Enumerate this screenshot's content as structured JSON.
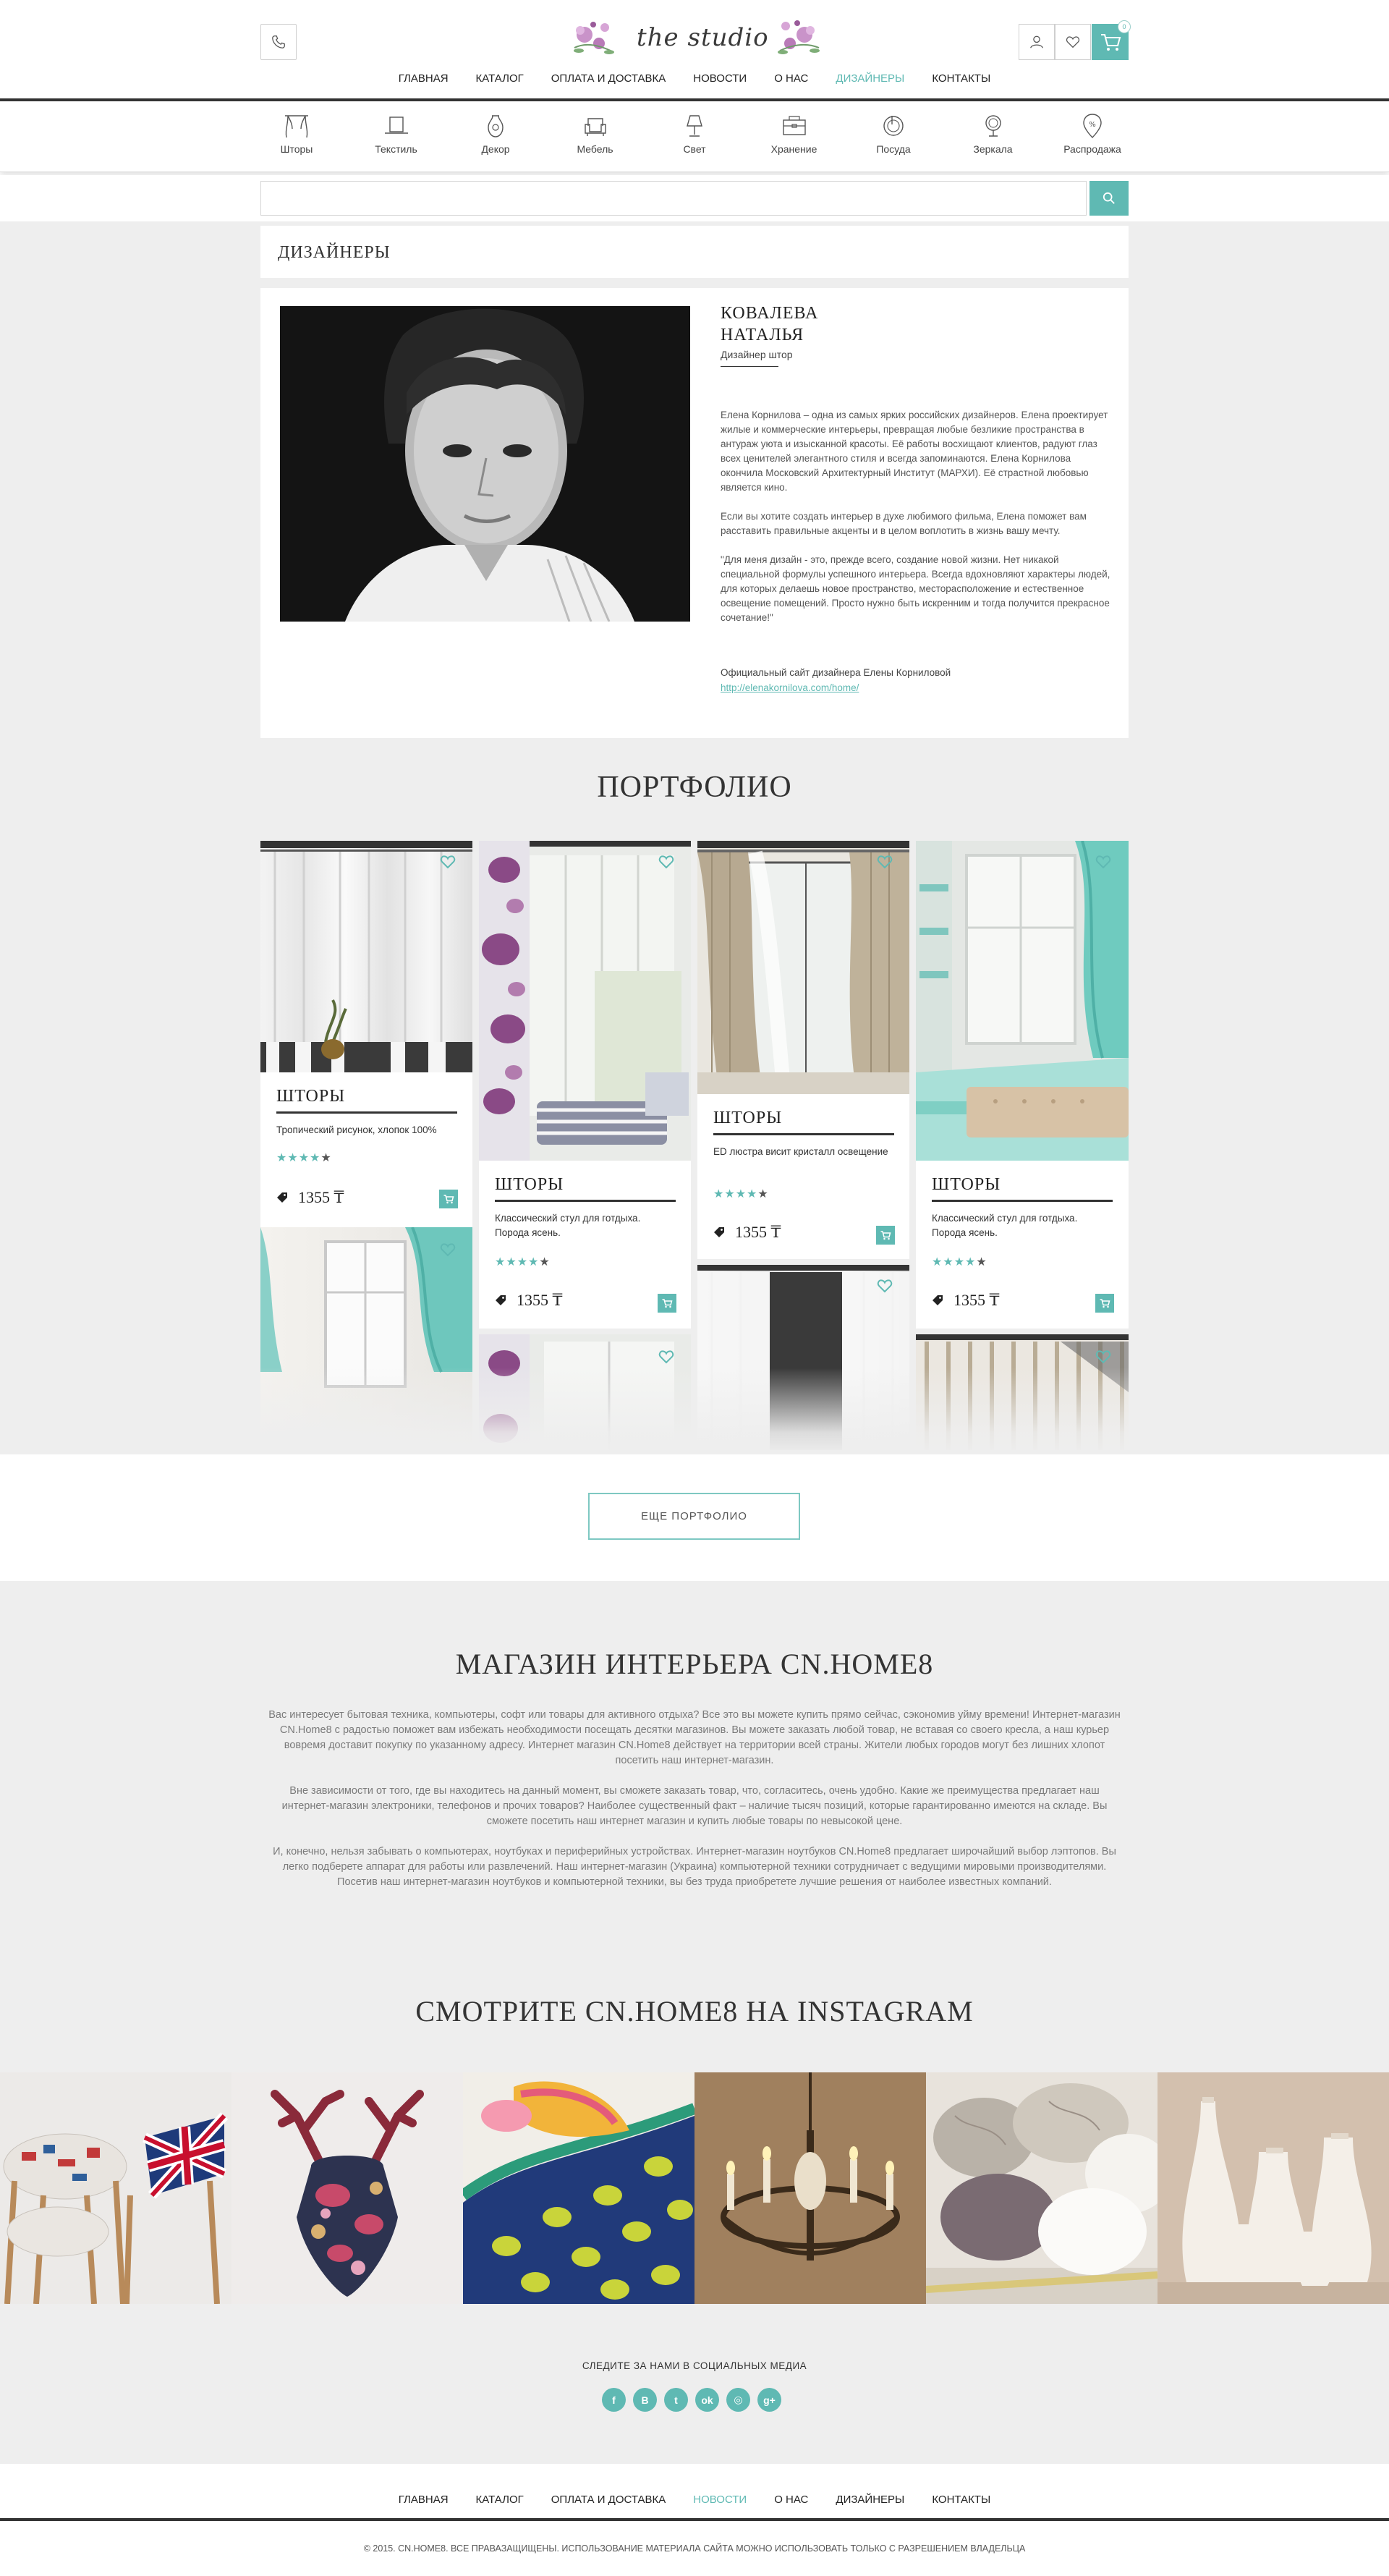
{
  "brand": {
    "logo_text": "the studio",
    "accent": "#5fb9b3"
  },
  "header": {
    "icons": [
      "phone-icon",
      "user-icon",
      "heart-icon",
      "cart-icon"
    ],
    "cart_count": "0",
    "nav": [
      {
        "label": "ГЛАВНАЯ",
        "active": false
      },
      {
        "label": "КАТАЛОГ",
        "active": false
      },
      {
        "label": "ОПЛАТА И ДОСТАВКА",
        "active": false
      },
      {
        "label": "НОВОСТИ",
        "active": false
      },
      {
        "label": "О НАС",
        "active": false
      },
      {
        "label": "ДИЗАЙНЕРЫ",
        "active": true
      },
      {
        "label": "КОНТАКТЫ",
        "active": false
      }
    ]
  },
  "categories": [
    {
      "label": "Шторы",
      "icon": "curtains-icon"
    },
    {
      "label": "Текстиль",
      "icon": "hat-icon"
    },
    {
      "label": "Декор",
      "icon": "vase-icon"
    },
    {
      "label": "Мебель",
      "icon": "armchair-icon"
    },
    {
      "label": "Свет",
      "icon": "lamp-icon"
    },
    {
      "label": "Хранение",
      "icon": "box-icon"
    },
    {
      "label": "Посуда",
      "icon": "plate-icon"
    },
    {
      "label": "Зеркала",
      "icon": "mirror-icon"
    },
    {
      "label": "Распродажа",
      "icon": "tag-icon"
    }
  ],
  "search": {
    "placeholder": "",
    "button_icon": "search-icon"
  },
  "page_title": "ДИЗАЙНЕРЫ",
  "designer": {
    "name_line1": "КОВАЛЕВА",
    "name_line2": "НАТАЛЬЯ",
    "role": "Дизайнер штор",
    "bio": [
      "Елена Корнилова – одна из самых ярких российских дизайнеров. Елена проектирует  жилые и коммерческие интерьеры, превращая любые безликие пространства в антураж уюта и изысканной красоты. Её работы восхищают клиентов, радуют глаз всех ценителей элегантного стиля и всегда запоминаются.  Елена Корнилова окончила Московский Архитектурный Институт (МАРХИ).  Её страстной любовью является кино.",
      "Если вы хотите создать интерьер в духе любимого фильма, Елена поможет вам расставить правильные акценты и в целом воплотить в жизнь вашу мечту.",
      "\"Для меня дизайн - это, прежде всего, создание новой жизни. Нет никакой специальной формулы успешного интерьера. Всегда вдохновляют характеры людей, для которых делаешь новое пространство, месторасположение и естественное освещение помещений. Просто нужно быть искренним и тогда получится прекрасное сочетание!\""
    ],
    "site_label": "Официальный сайт дизайнера Елены Корниловой",
    "site_url": "http://elenakornilova.com/home/"
  },
  "portfolio": {
    "heading": "ПОРТФОЛИО",
    "items": [
      {
        "title": "ШТОРЫ",
        "desc": "Тропический рисунок, хлопок 100%",
        "rating": 4,
        "price": "1355 ₸"
      },
      {
        "title": "ШТОРЫ",
        "desc": "Классический стул для готдыха. Порода ясень.",
        "rating": 4,
        "price": "1355 ₸"
      },
      {
        "title": "ШТОРЫ",
        "desc": "ED люстра висит кристалл освещение",
        "rating": 4,
        "price": "1355 ₸"
      },
      {
        "title": "ШТОРЫ",
        "desc": "Классический стул для готдыха. Порода ясень.",
        "rating": 4,
        "price": "1355 ₸"
      }
    ],
    "more_button": "ЕЩЕ ПОРТФОЛИО"
  },
  "about": {
    "heading": "МАГАЗИН ИНТЕРЬЕРА CN.Home8",
    "paragraphs": [
      "Вас интересует бытовая техника, компьютеры, софт или товары для активного отдыха? Все это вы можете купить прямо сейчас, сэкономив уйму времени! Интернет-магазин CN.Home8 с радостью поможет вам избежать необходимости посещать десятки магазинов. Вы можете заказать любой товар, не вставая со своего кресла, а наш курьер вовремя доставит покупку по указанному адресу. Интернет магазин CN.Home8 действует на территории всей страны. Жители любых городов могут без лишних хлопот посетить наш интернет-магазин.",
      "Вне зависимости от того, где вы находитесь на данный момент, вы сможете заказать товар, что, согласитесь, очень удобно. Какие же преимущества предлагает наш интернет-магазин электроники, телефонов и прочих товаров? Наиболее существенный факт – наличие тысяч позиций, которые гарантированно имеются на складе. Вы сможете посетить наш интернет магазин и купить любые товары по невысокой цене.",
      "И, конечно, нельзя забывать о компьютерах, ноутбуках и периферийных устройствах. Интернет-магазин ноутбуков CN.Home8 предлагает широчайший выбор лэптопов. Вы легко подберете аппарат для работы или развлечений. Наш интернет-магазин (Украина) компьютерной техники сотрудничает с ведущими мировыми производителями. Посетив наш интернет-магазин ноутбуков и компьютерной техники, вы без труда приобретете лучшие решения от наиболее известных компаний."
    ]
  },
  "instagram": {
    "heading": "СМОТРИТЕ CN.Home8 НА INSTAGRAM"
  },
  "footer": {
    "follow_label": "СЛЕДИТЕ ЗА НАМИ В СОЦИАЛЬНЫХ МЕДИА",
    "socials": [
      {
        "label": "f",
        "icon": "facebook-icon"
      },
      {
        "label": "B",
        "icon": "vk-icon"
      },
      {
        "label": "t",
        "icon": "twitter-icon"
      },
      {
        "label": "ok",
        "icon": "odnoklassniki-icon"
      },
      {
        "label": "◎",
        "icon": "instagram-icon"
      },
      {
        "label": "g+",
        "icon": "google-plus-icon"
      }
    ],
    "nav": [
      {
        "label": "ГЛАВНАЯ",
        "active": false
      },
      {
        "label": "КАТАЛОГ",
        "active": false
      },
      {
        "label": "ОПЛАТА И ДОСТАВКА",
        "active": false
      },
      {
        "label": "НОВОСТИ",
        "active": true
      },
      {
        "label": "О НАС",
        "active": false
      },
      {
        "label": "ДИЗАЙНЕРЫ",
        "active": false
      },
      {
        "label": "КОНТАКТЫ",
        "active": false
      }
    ],
    "copyright": "© 2015. CN.HOME8. ВСЕ ПРАВАЗАЩИЩЕНЫ. ИСПОЛЬЗОВАНИЕ МАТЕРИАЛА САЙТА МОЖНО ИСПОЛЬЗОВАТЬ ТОЛЬКО С РАЗРЕШЕНИЕМ ВЛАДЕЛЬЦА"
  }
}
